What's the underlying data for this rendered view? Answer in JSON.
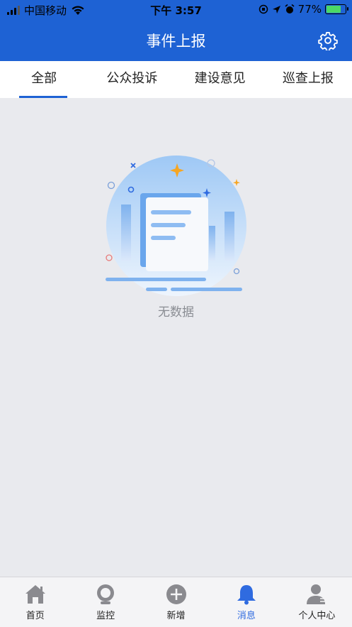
{
  "status_bar": {
    "carrier": "中国移动",
    "time": "下午 3:57",
    "battery_percent": "77%",
    "battery_level": 0.77
  },
  "header": {
    "title": "事件上报",
    "settings_icon": "gear-icon"
  },
  "tabs": [
    {
      "label": "全部",
      "active": true
    },
    {
      "label": "公众投诉",
      "active": false
    },
    {
      "label": "建设意见",
      "active": false
    },
    {
      "label": "巡查上报",
      "active": false
    }
  ],
  "empty_state": {
    "text": "无数据",
    "illustration": "empty-document-illustration"
  },
  "bottom_nav": [
    {
      "label": "首页",
      "icon": "home-icon",
      "active": false
    },
    {
      "label": "监控",
      "icon": "camera-icon",
      "active": false
    },
    {
      "label": "新增",
      "icon": "plus-circle-icon",
      "active": false
    },
    {
      "label": "消息",
      "icon": "bell-icon",
      "active": true
    },
    {
      "label": "个人中心",
      "icon": "user-icon",
      "active": false
    }
  ],
  "colors": {
    "primary": "#1e62d4",
    "background": "#e9eaee",
    "active_nav": "#2f6be0",
    "inactive_icon": "#8a8a8f"
  }
}
